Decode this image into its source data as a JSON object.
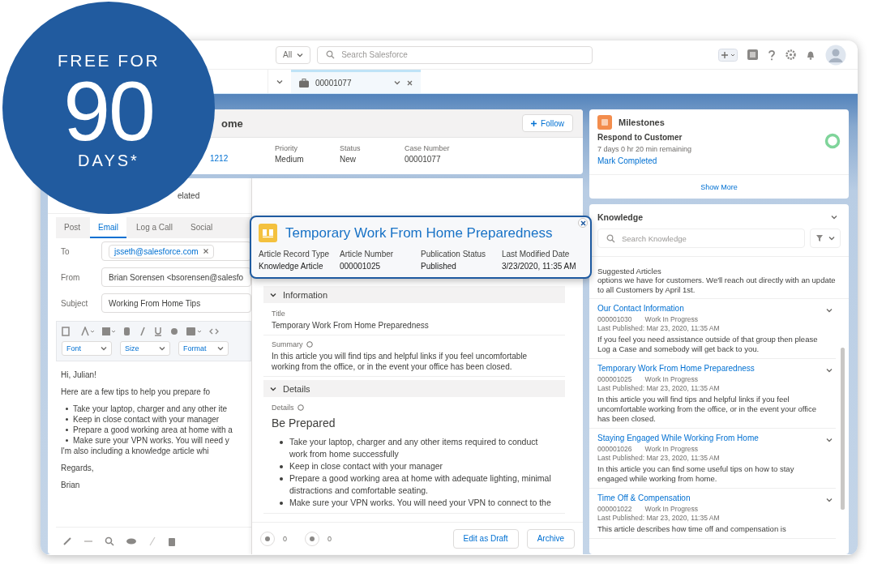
{
  "promo": {
    "line1": "FREE FOR",
    "number": "90",
    "line2": "DAYS*"
  },
  "header": {
    "scope": "All",
    "search_placeholder": "Search Salesforce"
  },
  "tabs": [
    {
      "label": "00001077",
      "selected": true
    }
  ],
  "case": {
    "title": "ome",
    "follow": "Follow",
    "link": "1212",
    "fields": [
      {
        "label": "Priority",
        "value": "Medium"
      },
      {
        "label": "Status",
        "value": "New"
      },
      {
        "label": "Case Number",
        "value": "00001077"
      }
    ],
    "related": "elated"
  },
  "composer": {
    "tabs": [
      {
        "label": "Post",
        "selected": false
      },
      {
        "label": "Email",
        "selected": true
      },
      {
        "label": "Log a Call",
        "selected": false
      },
      {
        "label": "Social",
        "selected": false
      }
    ],
    "to_label": "To",
    "to": "jsseth@salesforce.com",
    "from_label": "From",
    "from": "Brian Sorensen <bsorensen@salesfo",
    "subject_label": "Subject",
    "subject": "Working From Home Tips",
    "dropdowns": [
      "Font",
      "Size",
      "Format"
    ],
    "body": [
      {
        "kind": "p",
        "text": "Hi, Julian!"
      },
      {
        "kind": "p",
        "text": "Here are a few tips to help you prepare fo"
      },
      {
        "kind": "li",
        "text": "Take your laptop, charger and any other ite"
      },
      {
        "kind": "li",
        "text": "Keep in close contact with your manager"
      },
      {
        "kind": "li",
        "text": "Prepare a good working area at home with a"
      },
      {
        "kind": "li",
        "text": "Make sure your VPN works. You will need y"
      },
      {
        "kind": "p",
        "text": "I'm also including a knowledge article whi"
      },
      {
        "kind": "p",
        "text": "Regards,"
      },
      {
        "kind": "line",
        "text": "Brian"
      }
    ]
  },
  "article": {
    "info_title": "Information",
    "title_label": "Title",
    "title": "Temporary Work From Home Preparedness",
    "summary_label": "Summary",
    "summary": "In this article you will find tips and helpful links if you feel uncomfortable working from the office, or in the event your office has been closed.",
    "details_title": "Details",
    "details_label": "Details",
    "heading": "Be Prepared",
    "bullets": [
      "Take your laptop, charger and any other items required to conduct work from home successfully",
      "Keep in close contact with your manager",
      "Prepare a good working area at home with adequate lighting, minimal distractions and comfortable seating.",
      "Make sure your VPN works. You will need your VPN to connect to the"
    ],
    "counts": [
      "0",
      "0"
    ],
    "buttons": [
      "Edit as Draft",
      "Archive"
    ]
  },
  "popover": {
    "title": "Temporary Work From Home Preparedness",
    "fields": [
      {
        "label": "Article Record Type",
        "value": "Knowledge Article"
      },
      {
        "label": "Article Number",
        "value": "000001025"
      },
      {
        "label": "Publication Status",
        "value": "Published"
      },
      {
        "label": "Last Modified Date",
        "value": "3/23/2020, 11:35 AM"
      }
    ]
  },
  "milestones": {
    "title": "Milestones",
    "item": "Respond to Customer",
    "remaining": "7 days 0 hr 20 min remaining",
    "action": "Mark Completed",
    "more": "Show More"
  },
  "knowledge": {
    "title": "Knowledge",
    "search_placeholder": "Search Knowledge",
    "section": "Suggested Articles",
    "preview": "options we have for customers. We'll reach out directly with an update to all Customers by April 1st.",
    "articles": [
      {
        "title": "Our Contact Information",
        "number": "000001030",
        "status": "Work In Progress",
        "published": "Last Published: Mar 23, 2020, 11:35 AM",
        "summary": "If you feel you need assistance outside of that group then please Log a Case and somebody will get back to you."
      },
      {
        "title": "Temporary Work From Home Preparedness",
        "number": "000001025",
        "status": "Work In Progress",
        "published": "Last Published: Mar 23, 2020, 11:35 AM",
        "summary": "In this article you will find tips and helpful links if you feel uncomfortable working from the office, or in the event your office has been closed."
      },
      {
        "title": "Staying Engaged While Working From Home",
        "number": "000001026",
        "status": "Work In Progress",
        "published": "Last Published: Mar 23, 2020, 11:35 AM",
        "summary": "In this article you can find some useful tips on how to stay engaged while working from home."
      },
      {
        "title": "Time Off & Compensation",
        "number": "000001022",
        "status": "Work In Progress",
        "published": "Last Published: Mar 23, 2020, 11:35 AM",
        "summary": "This article describes how time off and compensation is"
      }
    ]
  }
}
